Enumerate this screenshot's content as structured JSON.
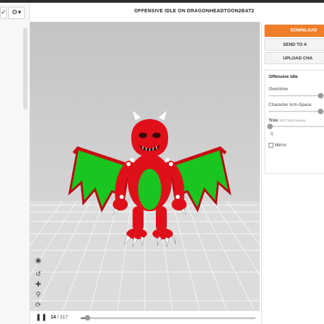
{
  "header": {
    "title": "OFFENSIVE IDLE ON DRAGONHEADTOON2BAT2"
  },
  "left_rail": {
    "check_icon": "checkmark-icon",
    "settings_icon": "gear-icon"
  },
  "viewport_tools": [
    "skull-icon",
    "reset-icon",
    "move-icon",
    "zoom-icon",
    "rotate-icon",
    "camera-icon"
  ],
  "playback": {
    "current_frame": "14",
    "total_frames": "/ 317",
    "progress": 0.04
  },
  "right_panel": {
    "download_label": "DOWNLOAD",
    "send_label": "SEND TO A",
    "upload_label": "UPLOAD CHA"
  },
  "settings": {
    "title": "Offensive Idle",
    "overdrive": {
      "label": "Overdrive",
      "value": 0.8
    },
    "arm_space": {
      "label": "Character Arm-Space",
      "value": 0.8
    },
    "trim": {
      "label": "Trim",
      "note": "349 Total Frames",
      "value": "0"
    },
    "mirror": {
      "label": "Mirror",
      "checked": false
    }
  },
  "colors": {
    "accent": "#ef7f2a",
    "dragon_body": "#e0101a",
    "dragon_wing": "#19c51f"
  }
}
